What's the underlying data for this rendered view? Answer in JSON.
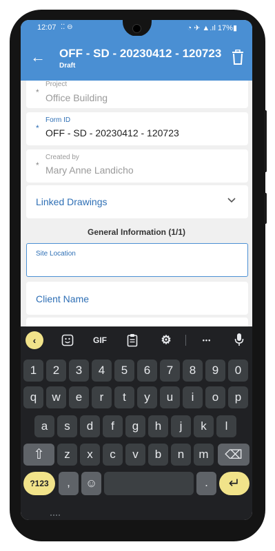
{
  "status": {
    "time": "12:07",
    "left_icons": "⁚⁚ ⊖",
    "right_icons": "◔ ✈ ▲.ıl 17%▮",
    "battery": "17%"
  },
  "appbar": {
    "title": "OFF - SD - 20230412 - 120723",
    "subtitle": "Draft"
  },
  "fields": [
    {
      "label": "Project",
      "value": "Office Building",
      "required": true,
      "readonly": true
    },
    {
      "label": "Form ID",
      "value": "OFF - SD - 20230412 - 120723",
      "required": true,
      "readonly": false
    },
    {
      "label": "Created by",
      "value": "Mary Anne Landicho",
      "required": true,
      "readonly": true
    }
  ],
  "linked_drawings": {
    "label": "Linked Drawings"
  },
  "general_info": {
    "header": "General Information (1/1)"
  },
  "site_location": {
    "label": "Site Location",
    "value": ""
  },
  "client_name": {
    "label": "Client Name"
  },
  "keyboard": {
    "toolbar": {
      "back": "‹",
      "sticker": "☺",
      "gif": "GIF",
      "clipboard": "▤",
      "settings": "⚙",
      "more": "•••",
      "mic": "🎤"
    },
    "row_numbers": [
      "1",
      "2",
      "3",
      "4",
      "5",
      "6",
      "7",
      "8",
      "9",
      "0"
    ],
    "row_q": [
      "q",
      "w",
      "e",
      "r",
      "t",
      "y",
      "u",
      "i",
      "o",
      "p"
    ],
    "row_a": [
      "a",
      "s",
      "d",
      "f",
      "g",
      "h",
      "j",
      "k",
      "l"
    ],
    "row_z": [
      "z",
      "x",
      "c",
      "v",
      "b",
      "n",
      "m"
    ],
    "shift": "⇧",
    "backspace": "⌫",
    "sym_key": "?123",
    "comma": ",",
    "emoji": "☺",
    "period": ".",
    "enter": "↵"
  },
  "colors": {
    "accent": "#4a8fd3",
    "link": "#2e6fb5",
    "keyboard_bg": "#202124",
    "key": "#3c4043",
    "action_key": "#f1e38a"
  }
}
